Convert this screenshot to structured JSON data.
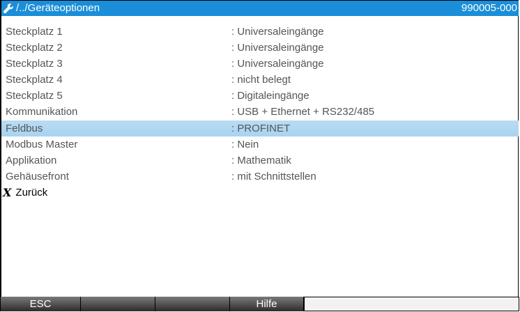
{
  "titlebar": {
    "icon": "wrench-icon",
    "path": "/../Geräteoptionen",
    "id": "990005-000"
  },
  "rows": [
    {
      "label": "Steckplatz 1",
      "value": ": Universaleingänge"
    },
    {
      "label": "Steckplatz 2",
      "value": ": Universaleingänge"
    },
    {
      "label": "Steckplatz 3",
      "value": ": Universaleingänge"
    },
    {
      "label": "Steckplatz 4",
      "value": ": nicht belegt"
    },
    {
      "label": "Steckplatz 5",
      "value": ": Digitaleingänge"
    },
    {
      "label": "Kommunikation",
      "value": ": USB + Ethernet + RS232/485"
    },
    {
      "label": "Feldbus",
      "value": ": PROFINET"
    },
    {
      "label": "Modbus Master",
      "value": ": Nein"
    },
    {
      "label": "Applikation",
      "value": ": Mathematik"
    },
    {
      "label": "Gehäusefront",
      "value": ": mit Schnittstellen"
    }
  ],
  "selected_row": "Feldbus",
  "back": {
    "icon_glyph": "X",
    "label": "Zurück"
  },
  "softkeys": [
    {
      "label": "ESC"
    },
    {
      "label": ""
    },
    {
      "label": ""
    },
    {
      "label": "Hilfe"
    },
    {
      "label": ""
    }
  ],
  "colors": {
    "title_bg": "#1a8ed8",
    "selection_bg": "#b2d8f2",
    "softkey_bg": "#3c3c3c"
  }
}
